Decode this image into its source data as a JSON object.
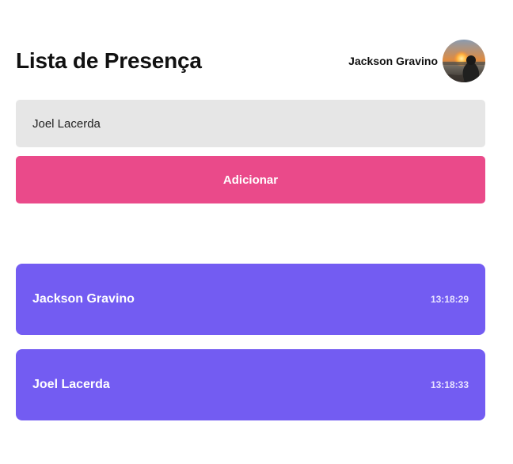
{
  "header": {
    "title": "Lista de Presença",
    "user_name": "Jackson Gravino",
    "avatar_icon": "user-avatar-photo"
  },
  "form": {
    "input_value": "Joel Lacerda",
    "button_label": "Adicionar"
  },
  "cards": [
    {
      "name": "Jackson Gravino",
      "time": "13:18:29"
    },
    {
      "name": "Joel Lacerda",
      "time": "13:18:33"
    }
  ],
  "colors": {
    "input_background": "#e6e6e6",
    "button_background": "#ea4a8a",
    "card_background": "#735cf2"
  }
}
